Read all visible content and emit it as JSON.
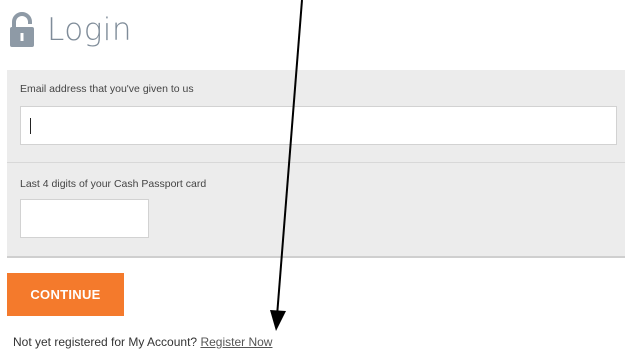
{
  "header": {
    "title": "Login",
    "lock_icon": "lock-icon"
  },
  "email_field": {
    "label": "Email address that you've given to us",
    "value": ""
  },
  "card_field": {
    "label": "Last 4 digits of your Cash Passport card",
    "value": ""
  },
  "continue_button": {
    "label": "CONTINUE"
  },
  "footer": {
    "prompt": "Not yet registered for My Account?",
    "link": "Register Now"
  },
  "colors": {
    "accent": "#f47a2c",
    "panel_bg": "#ececec",
    "title": "#7f8c99"
  }
}
